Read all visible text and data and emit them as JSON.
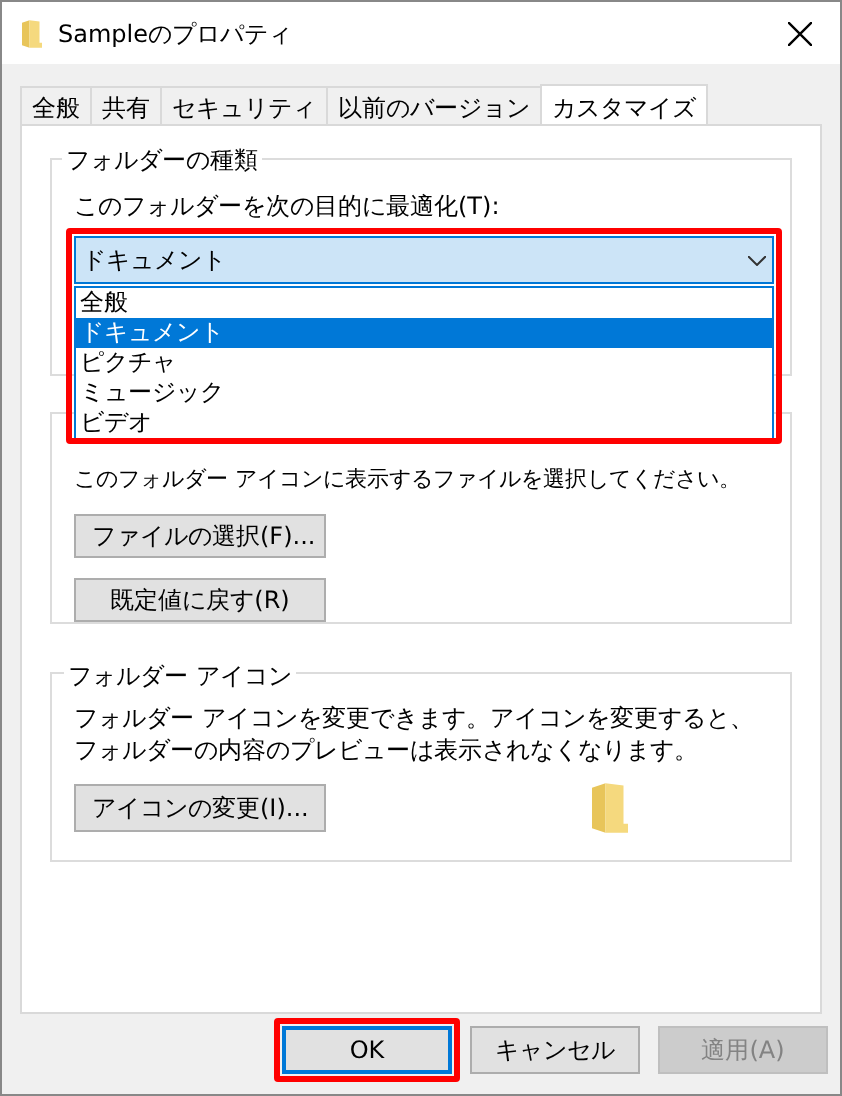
{
  "window": {
    "title": "Sampleのプロパティ"
  },
  "tabs": [
    {
      "label": "全般",
      "selected": false
    },
    {
      "label": "共有",
      "selected": false
    },
    {
      "label": "セキュリティ",
      "selected": false
    },
    {
      "label": "以前のバージョン",
      "selected": false
    },
    {
      "label": "カスタマイズ",
      "selected": true
    }
  ],
  "folder_type": {
    "title": "フォルダーの種類",
    "label": "このフォルダーを次の目的に最適化(T):",
    "value": "ドキュメント",
    "highlighted": true,
    "options": [
      {
        "label": "全般",
        "selected": false
      },
      {
        "label": "ドキュメント",
        "selected": true
      },
      {
        "label": "ピクチャ",
        "selected": false
      },
      {
        "label": "ミュージック",
        "selected": false
      },
      {
        "label": "ビデオ",
        "selected": false
      }
    ]
  },
  "folder_picture": {
    "text": "このフォルダー アイコンに表示するファイルを選択してください。",
    "buttons": [
      "ファイルの選択(F)...",
      "既定値に戻す(R)"
    ]
  },
  "folder_icon": {
    "title": "フォルダー アイコン",
    "text": "フォルダー アイコンを変更できます。アイコンを変更すると、フォルダーの内容のプレビューは表示されなくなります。",
    "button": "アイコンの変更(I)..."
  },
  "buttons": [
    {
      "label": "OK",
      "disabled": false,
      "highlighted": true
    },
    {
      "label": "キャンセル",
      "disabled": false,
      "highlighted": false
    },
    {
      "label": "適用(A)",
      "disabled": true,
      "highlighted": false
    }
  ]
}
